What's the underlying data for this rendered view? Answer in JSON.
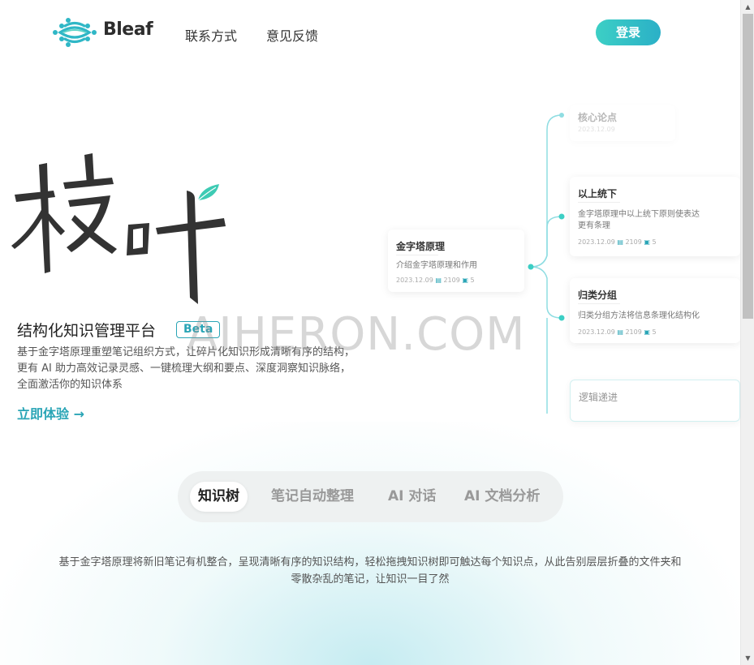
{
  "header": {
    "brand": "Bleaf",
    "nav": {
      "contact": "联系方式",
      "feedback": "意见反馈"
    },
    "login": "登录"
  },
  "hero": {
    "calligraphy": "枝叶",
    "subtitle": "结构化知识管理平台",
    "badge": "Beta",
    "description": "基于金字塔原理重塑笔记组织方式，让碎片化知识形成清晰有序的结构，更有 AI 助力高效记录灵感、一键梳理大纲和要点、深度洞察知识脉络，全面激活你的知识体系",
    "cta": "立即体验",
    "cta_arrow": "→"
  },
  "watermark": "AIHERON.COM",
  "mindmap": {
    "root": {
      "title": "金字塔原理",
      "desc": "介绍金字塔原理和作用",
      "date": "2023.12.09",
      "words": "2109",
      "count": "5"
    },
    "top_faded": {
      "title": "核心论点",
      "date": "2023.12.09"
    },
    "child1": {
      "title": "以上统下",
      "desc": "金字塔原理中以上统下原则使表达更有条理",
      "date": "2023.12.09",
      "words": "2109",
      "count": "5"
    },
    "child2": {
      "title": "归类分组",
      "desc": "归类分组方法将信息条理化结构化",
      "date": "2023.12.09",
      "words": "2109",
      "count": "5"
    },
    "child3": {
      "title": "逻辑递进"
    }
  },
  "tabs": [
    "知识树",
    "笔记自动整理",
    "AI 对话",
    "AI 文档分析"
  ],
  "section": {
    "description": "基于金字塔原理将新旧笔记有机整合，呈现清晰有序的知识结构，轻松拖拽知识树即可触达每个知识点，从此告别层层折叠的文件夹和零散杂乱的笔记，让知识一目了然"
  },
  "colors": {
    "accent": "#2aa5b6",
    "login_gradient_start": "#3ccfc5",
    "login_gradient_end": "#2bb0c7",
    "leaf": "#3ecbb4"
  },
  "icons": {
    "logo": "bleaf-logo-icon",
    "scroll_up": "chevron-up-icon",
    "scroll_down": "chevron-down-icon"
  }
}
